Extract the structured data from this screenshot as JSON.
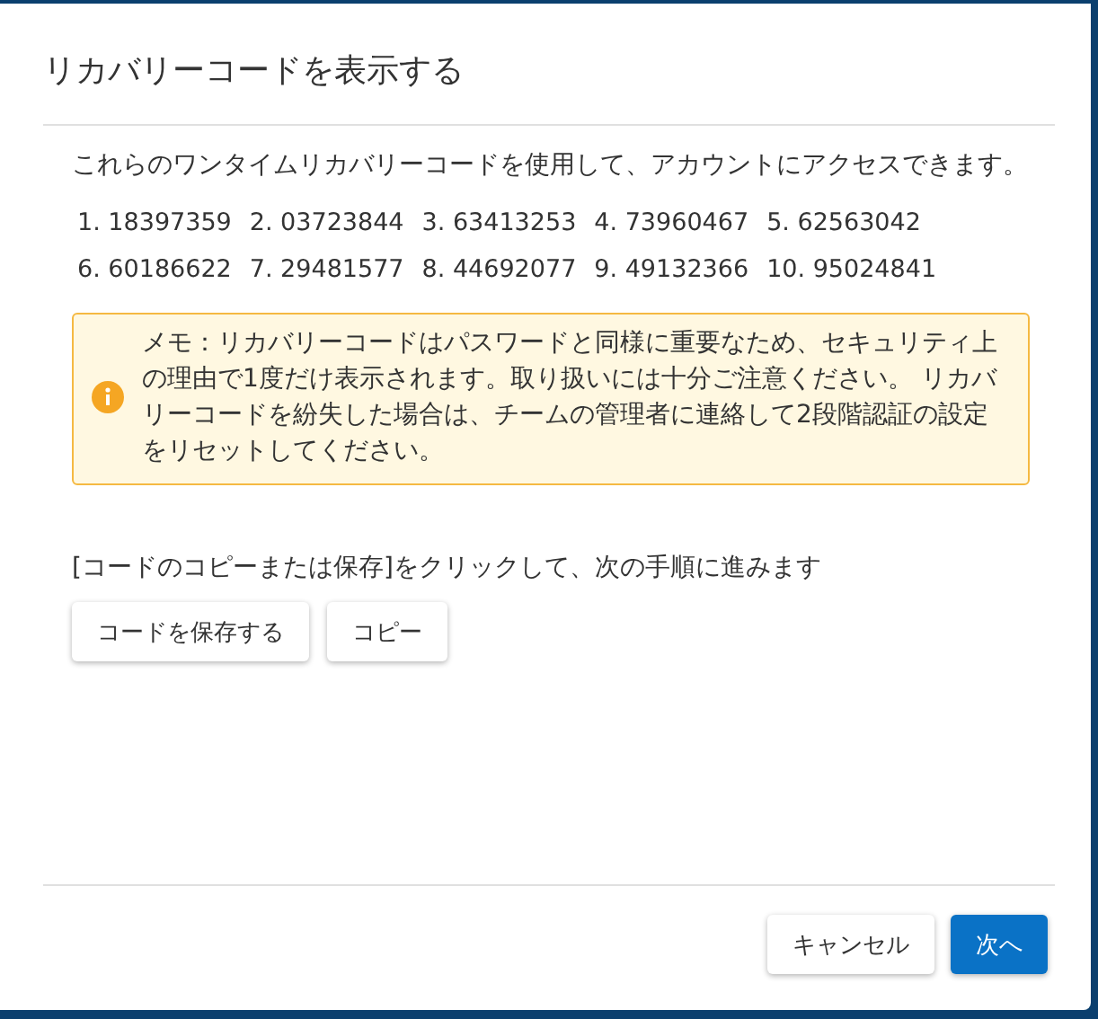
{
  "dialog": {
    "title": "リカバリーコードを表示する"
  },
  "intro": "これらのワンタイムリカバリーコードを使用して、アカウントにアクセスできます。",
  "code_rows": [
    [
      "1. 18397359",
      "2. 03723844",
      "3. 63413253",
      "4. 73960467",
      "5. 62563042"
    ],
    [
      "6. 60186622",
      "7. 29481577",
      "8. 44692077",
      "9. 49132366",
      "10. 95024841"
    ]
  ],
  "notice": {
    "kind": "warning",
    "text": "メモ：リカバリーコードはパスワードと同様に重要なため、セキュリティ上の理由で1度だけ表示されます。取り扱いには十分ご注意ください。 リカバリーコードを紛失した場合は、チームの管理者に連絡して2段階認証の設定をリセットしてください。"
  },
  "instruction": "[コードのコピーまたは保存]をクリックして、次の手順に進みます",
  "action_buttons": [
    "コードを保存する",
    "コピー"
  ],
  "footer_buttons": [
    {
      "label": "キャンセル",
      "kind": "secondary"
    },
    {
      "label": "次へ",
      "kind": "primary"
    }
  ]
}
